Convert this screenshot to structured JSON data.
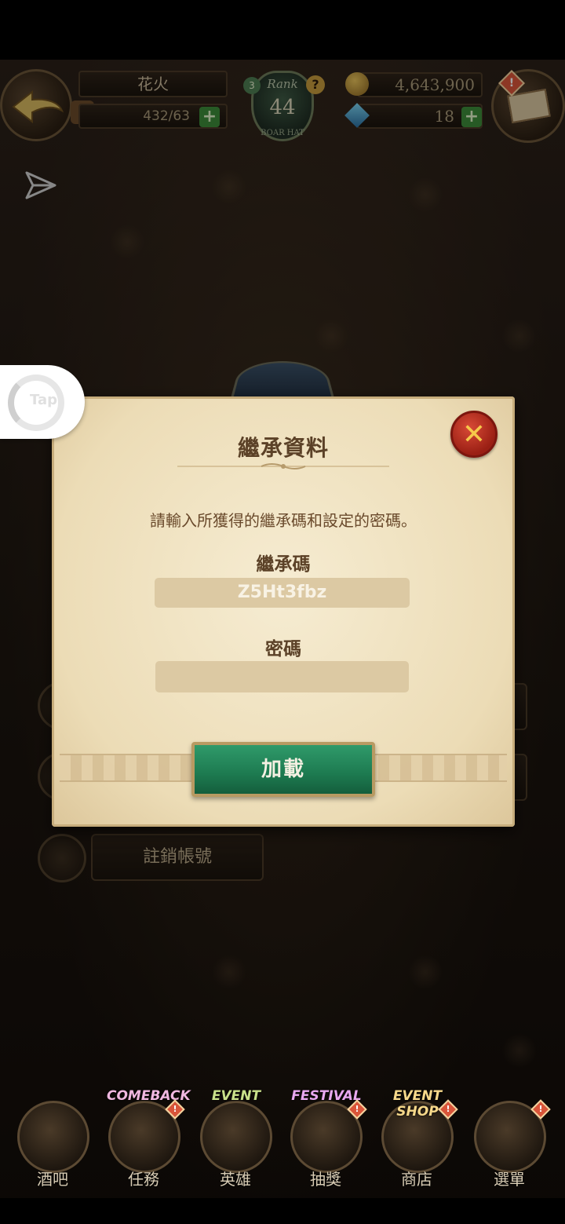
{
  "header": {
    "player_name": "花火",
    "stamina": "432/63",
    "rank_label": "Rank",
    "rank": "44",
    "rank_title": "BOAR HAT",
    "gold": "4,643,900",
    "gems": "18"
  },
  "background_menu": {
    "delete_account_label": "註銷帳號"
  },
  "tap_widget": {
    "label": "Tap"
  },
  "dialog": {
    "title": "繼承資料",
    "instruction": "請輸入所獲得的繼承碼和設定的密碼。",
    "code_label": "繼承碼",
    "code_value": "Z5Ht3fbz",
    "password_label": "密碼",
    "password_value": "",
    "load_button": "加載"
  },
  "bottom_nav": {
    "items": [
      {
        "label": "酒吧",
        "badge": ""
      },
      {
        "label": "任務",
        "badge": "COMEBACK"
      },
      {
        "label": "英雄",
        "badge": "EVENT"
      },
      {
        "label": "抽獎",
        "badge": "FESTIVAL"
      },
      {
        "label": "商店",
        "badge": "EVENT SHOP"
      },
      {
        "label": "選單",
        "badge": ""
      }
    ]
  },
  "colors": {
    "accent_green": "#1d7a50",
    "close_red": "#c0392b",
    "parchment": "#f1e4c4"
  }
}
